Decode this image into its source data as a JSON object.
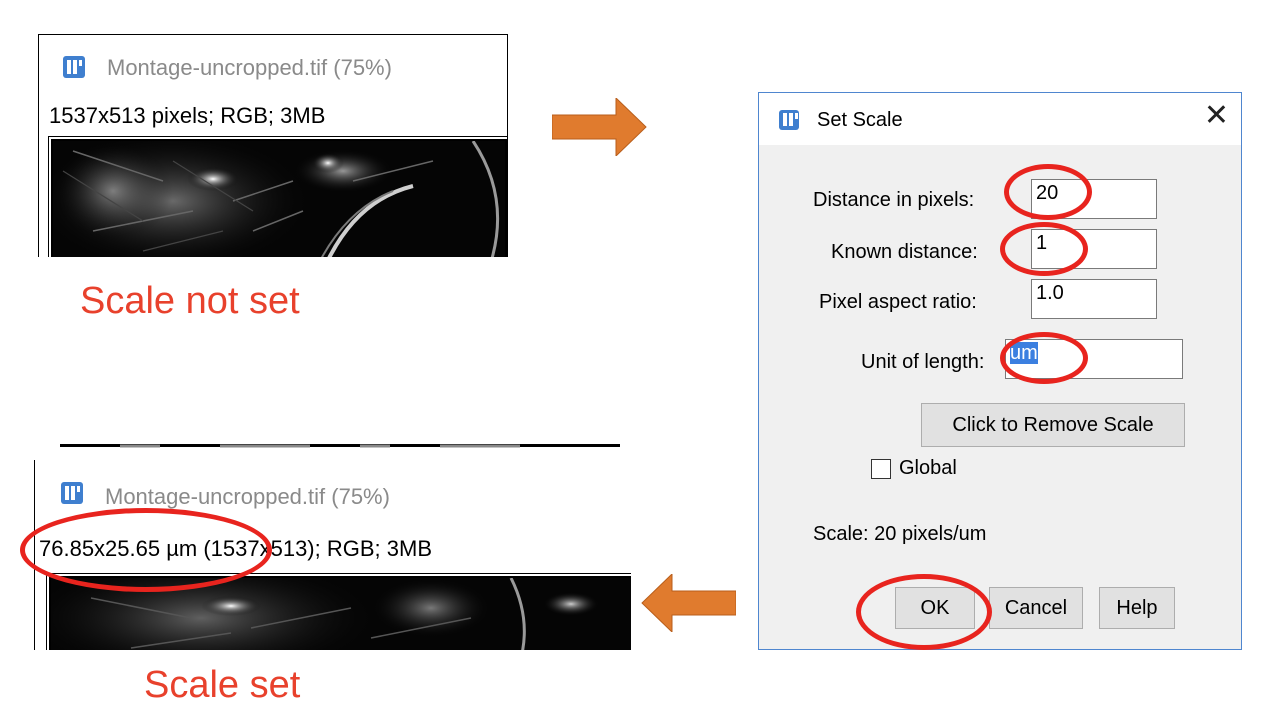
{
  "top_window": {
    "title": "Montage-uncropped.tif (75%)",
    "info": "1537x513 pixels; RGB; 3MB",
    "caption": "Scale not set"
  },
  "bottom_window": {
    "title": "Montage-uncropped.tif (75%)",
    "info": "76.85x25.65 µm (1537x513); RGB; 3MB",
    "caption": "Scale set"
  },
  "dialog": {
    "title": "Set Scale",
    "close_glyph": "✕",
    "fields": {
      "distance_label": "Distance in pixels:",
      "distance_value": "20",
      "known_label": "Known distance:",
      "known_value": "1",
      "aspect_label": "Pixel aspect ratio:",
      "aspect_value": "1.0",
      "unit_label": "Unit of length:",
      "unit_value": "um"
    },
    "remove_scale_label": "Click to Remove Scale",
    "global_label": "Global",
    "global_checked": false,
    "scale_text": "Scale: 20 pixels/um",
    "ok_label": "OK",
    "cancel_label": "Cancel",
    "help_label": "Help"
  },
  "colors": {
    "arrow": "#e07b2e",
    "annotation": "#e8241e",
    "caption": "#e8412c",
    "dialog_border": "#4f86cf"
  },
  "icons": {
    "window_icon": "imagej-icon",
    "arrow_right": "arrow-right-icon",
    "arrow_left": "arrow-left-icon"
  }
}
